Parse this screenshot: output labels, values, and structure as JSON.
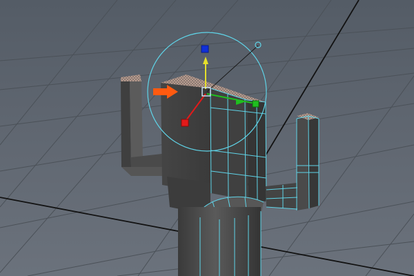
{
  "viewport": {
    "view": "perspective",
    "grid": true,
    "background_color": "#5c646d",
    "grid_color": "#4a4f55",
    "axis_line_color": "#111111"
  },
  "scene": {
    "object_color": "#4b4b4b",
    "selected_wire_color": "#5fd4e8",
    "selected_face_pattern": "checkered",
    "object_parts": [
      "left-arm",
      "main-torso",
      "right-arm",
      "shoulder-cap",
      "cylinder-base"
    ]
  },
  "manipulator": {
    "tool": "rotate",
    "active_handle": "orange-arrow",
    "colors": {
      "x_axis": "#e21a1a",
      "y_axis": "#e6e02a",
      "z_axis": "#1fbf1f",
      "up_cube": "#1030d8",
      "active_arrow": "#ff5a10",
      "ring": "#5fd4e8",
      "pivot": "#cfe8ff"
    }
  }
}
